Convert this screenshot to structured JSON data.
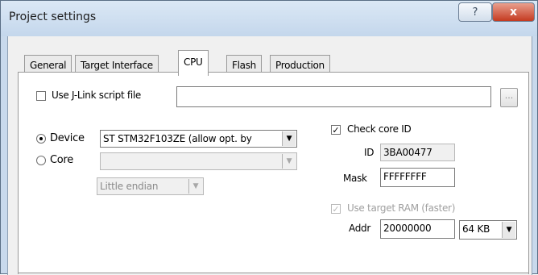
{
  "window": {
    "title": "Project settings",
    "help_label": "?",
    "close_label": "x"
  },
  "tabs": [
    {
      "label": "General"
    },
    {
      "label": "Target Interface"
    },
    {
      "label": "CPU"
    },
    {
      "label": "Flash"
    },
    {
      "label": "Production"
    }
  ],
  "active_tab": "CPU",
  "script_file": {
    "label": "Use J-Link script file",
    "checked": false,
    "value": "",
    "browse_label": "..."
  },
  "device": {
    "radio_label": "Device",
    "selected": true,
    "value": "ST STM32F103ZE (allow opt. by",
    "arrow": "▼"
  },
  "core": {
    "radio_label": "Core",
    "selected": false,
    "value": "",
    "arrow": "▼",
    "endian": "Little endian"
  },
  "check_core_id": {
    "label": "Check core ID",
    "checked": true,
    "check_mark": "✓",
    "id_label": "ID",
    "id_value": "3BA00477",
    "mask_label": "Mask",
    "mask_value": "FFFFFFFF"
  },
  "target_ram": {
    "label": "Use target RAM (faster)",
    "checked": true,
    "check_mark": "✓",
    "addr_label": "Addr",
    "addr_value": "20000000",
    "size_value": "64 KB",
    "arrow": "▼"
  }
}
